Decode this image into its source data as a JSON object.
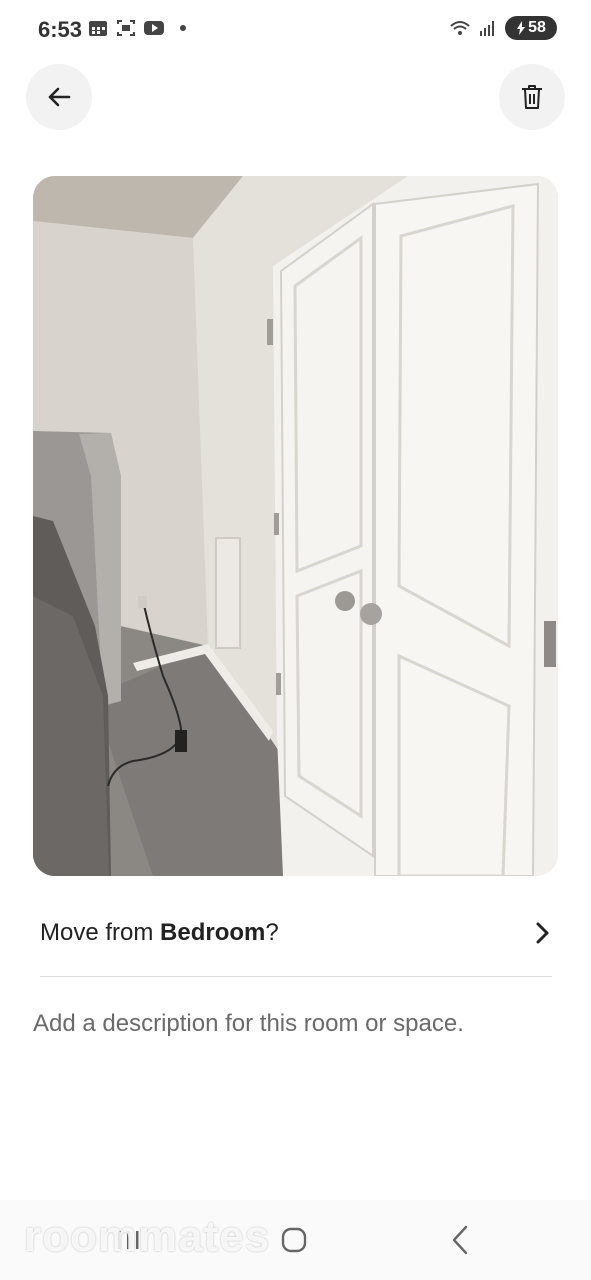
{
  "status_bar": {
    "time": "6:53",
    "battery": "58",
    "icons": [
      "calendar-icon",
      "screenshot-icon",
      "youtube-icon",
      "notification-dot",
      "wifi-icon",
      "signal-icon",
      "battery-charging-icon"
    ]
  },
  "header": {
    "back_icon": "arrow-left-icon",
    "delete_icon": "trash-icon"
  },
  "photo": {
    "subject": "room-photo"
  },
  "move_row": {
    "prefix": "Move from ",
    "room": "Bedroom",
    "suffix": "?",
    "chevron_icon": "chevron-right-icon"
  },
  "description": {
    "placeholder": "Add a description for this room or space."
  },
  "nav_bar": {
    "icons": [
      "recents-icon",
      "home-icon",
      "back-icon"
    ]
  },
  "watermark": {
    "text": "roommates"
  },
  "colors": {
    "text": "#222222",
    "placeholder": "#6a6a6a",
    "button_bg": "#f2f2f2",
    "divider": "#dddddd"
  }
}
